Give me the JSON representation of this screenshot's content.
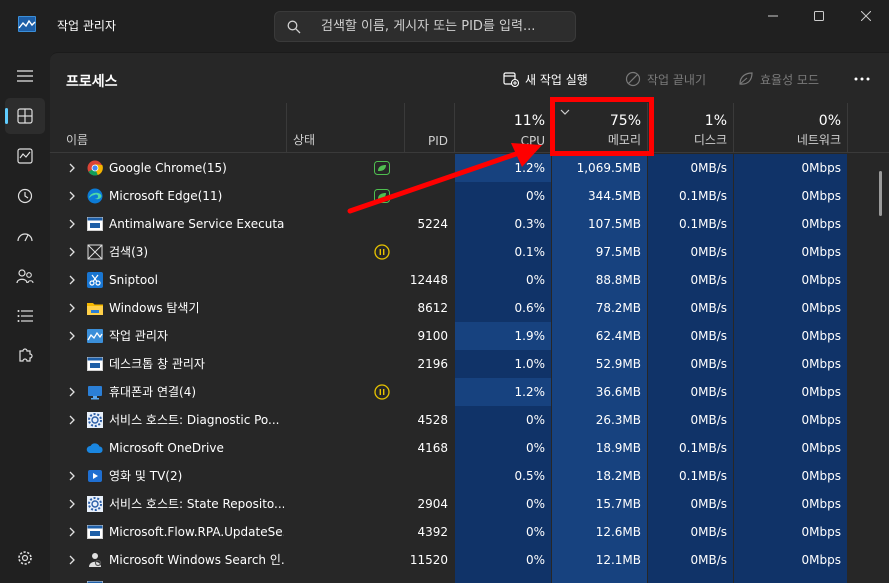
{
  "app": {
    "title": "작업 관리자"
  },
  "search": {
    "placeholder": "검색할 이름, 게시자 또는 PID를 입력..."
  },
  "toolbar": {
    "page_title": "프로세스",
    "new_task": "새 작업 실행",
    "end_task": "작업 끝내기",
    "efficiency": "효율성 모드"
  },
  "columns": {
    "name": "이름",
    "status": "상태",
    "pid": "PID",
    "cpu": {
      "pct": "11%",
      "label": "CPU"
    },
    "memory": {
      "pct": "75%",
      "label": "메모리"
    },
    "disk": {
      "pct": "1%",
      "label": "디스크"
    },
    "network": {
      "pct": "0%",
      "label": "네트워크"
    }
  },
  "colors": {
    "accent": "#60cdff",
    "heat_dark": "#103368",
    "heat_light": "#17427f",
    "annotation": "#ff0000",
    "efficiency_leaf": "#4fbf50",
    "suspended": "#e8c400"
  },
  "rows": [
    {
      "expand": true,
      "icon": "chrome-icon",
      "name": "Google Chrome(15)",
      "status": "efficiency",
      "pid": "",
      "cpu": "1.2%",
      "cpu_heat": true,
      "memory": "1,069.5MB",
      "disk": "0MB/s",
      "network": "0Mbps"
    },
    {
      "expand": true,
      "icon": "edge-icon",
      "name": "Microsoft Edge(11)",
      "status": "efficiency",
      "pid": "",
      "cpu": "0%",
      "cpu_heat": false,
      "memory": "344.5MB",
      "disk": "0.1MB/s",
      "network": "0Mbps"
    },
    {
      "expand": true,
      "icon": "app-window-icon",
      "name": "Antimalware Service Executa...",
      "status": "",
      "pid": "5224",
      "cpu": "0.3%",
      "cpu_heat": false,
      "memory": "107.5MB",
      "disk": "0.1MB/s",
      "network": "0Mbps"
    },
    {
      "expand": true,
      "icon": "search-app-icon",
      "name": "검색(3)",
      "status": "suspended",
      "pid": "",
      "cpu": "0.1%",
      "cpu_heat": false,
      "memory": "97.5MB",
      "disk": "0MB/s",
      "network": "0Mbps"
    },
    {
      "expand": true,
      "icon": "sniptool-icon",
      "name": "Sniptool",
      "status": "",
      "pid": "12448",
      "cpu": "0%",
      "cpu_heat": false,
      "memory": "88.8MB",
      "disk": "0MB/s",
      "network": "0Mbps"
    },
    {
      "expand": true,
      "icon": "folder-icon",
      "name": "Windows 탐색기",
      "status": "",
      "pid": "8612",
      "cpu": "0.6%",
      "cpu_heat": false,
      "memory": "78.2MB",
      "disk": "0MB/s",
      "network": "0Mbps"
    },
    {
      "expand": true,
      "icon": "task-manager-icon",
      "name": "작업 관리자",
      "status": "",
      "pid": "9100",
      "cpu": "1.9%",
      "cpu_heat": true,
      "memory": "62.4MB",
      "disk": "0MB/s",
      "network": "0Mbps"
    },
    {
      "expand": false,
      "icon": "app-window-icon",
      "name": "데스크톱 창 관리자",
      "status": "",
      "pid": "2196",
      "cpu": "1.0%",
      "cpu_heat": false,
      "memory": "52.9MB",
      "disk": "0MB/s",
      "network": "0Mbps"
    },
    {
      "expand": true,
      "icon": "phone-link-icon",
      "name": "휴대폰과 연결(4)",
      "status": "suspended",
      "pid": "",
      "cpu": "1.2%",
      "cpu_heat": true,
      "memory": "36.6MB",
      "disk": "0MB/s",
      "network": "0Mbps"
    },
    {
      "expand": true,
      "icon": "service-host-icon",
      "name": "서비스 호스트: Diagnostic Po...",
      "status": "",
      "pid": "4528",
      "cpu": "0%",
      "cpu_heat": false,
      "memory": "26.3MB",
      "disk": "0MB/s",
      "network": "0Mbps"
    },
    {
      "expand": false,
      "icon": "onedrive-icon",
      "name": "Microsoft OneDrive",
      "status": "",
      "pid": "4168",
      "cpu": "0%",
      "cpu_heat": false,
      "memory": "18.9MB",
      "disk": "0.1MB/s",
      "network": "0Mbps"
    },
    {
      "expand": true,
      "icon": "movies-tv-icon",
      "name": "영화 및 TV(2)",
      "status": "",
      "pid": "",
      "cpu": "0.5%",
      "cpu_heat": false,
      "memory": "18.2MB",
      "disk": "0.1MB/s",
      "network": "0Mbps"
    },
    {
      "expand": true,
      "icon": "service-host-icon",
      "name": "서비스 호스트: State Reposito...",
      "status": "",
      "pid": "2904",
      "cpu": "0%",
      "cpu_heat": false,
      "memory": "15.7MB",
      "disk": "0MB/s",
      "network": "0Mbps"
    },
    {
      "expand": true,
      "icon": "app-window-icon",
      "name": "Microsoft.Flow.RPA.UpdateSe...",
      "status": "",
      "pid": "4392",
      "cpu": "0%",
      "cpu_heat": false,
      "memory": "12.6MB",
      "disk": "0MB/s",
      "network": "0Mbps"
    },
    {
      "expand": true,
      "icon": "windows-search-icon",
      "name": "Microsoft Windows Search 인...",
      "status": "",
      "pid": "11520",
      "cpu": "0%",
      "cpu_heat": false,
      "memory": "12.1MB",
      "disk": "0MB/s",
      "network": "0Mbps"
    },
    {
      "expand": false,
      "icon": "app-window-icon",
      "name": "",
      "status": "",
      "pid": "",
      "cpu": "",
      "cpu_heat": false,
      "memory": "",
      "disk": "",
      "network": ""
    }
  ]
}
